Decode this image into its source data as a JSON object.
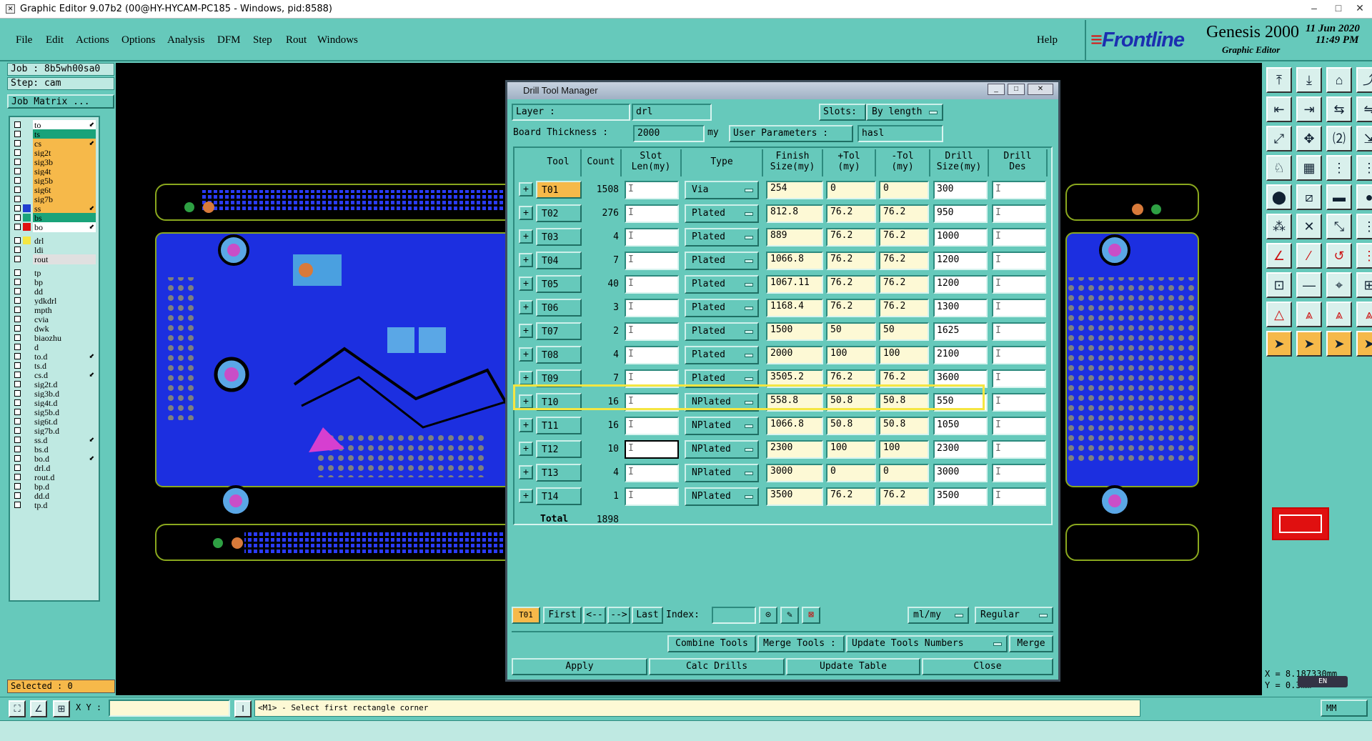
{
  "window": {
    "title": "Graphic Editor 9.07b2 (00@HY-HYCAM-PC185 - Windows, pid:8588)"
  },
  "menu": {
    "items": [
      "File",
      "Edit",
      "Actions",
      "Options",
      "Analysis",
      "DFM",
      "Step",
      "Rout",
      "Windows"
    ],
    "help": "Help"
  },
  "brand": {
    "logo": "Frontline",
    "product": "Genesis 2000",
    "subtitle": "Graphic Editor",
    "date": "11 Jun 2020",
    "time": "11:49 PM"
  },
  "left": {
    "job": "Job : 8b5wh00sa0",
    "step": "Step: cam",
    "job_matrix": "Job Matrix ...",
    "selected": "Selected : 0"
  },
  "layers": [
    {
      "name": "to",
      "color": "#ffffff",
      "arrow": true
    },
    {
      "name": "ts",
      "color": "#1aa37a",
      "arrow": false
    },
    {
      "name": "cs",
      "color": "#f6b94a",
      "arrow": true
    },
    {
      "name": "sig2t",
      "color": "#f6b94a",
      "arrow": false
    },
    {
      "name": "sig3b",
      "color": "#f6b94a",
      "arrow": false
    },
    {
      "name": "sig4t",
      "color": "#f6b94a",
      "arrow": false
    },
    {
      "name": "sig5b",
      "color": "#f6b94a",
      "arrow": false
    },
    {
      "name": "sig6t",
      "color": "#f6b94a",
      "arrow": false
    },
    {
      "name": "sig7b",
      "color": "#f6b94a",
      "arrow": false
    },
    {
      "name": "ss",
      "color": "#f6b94a",
      "arrow": true,
      "sw": "#1f3fd0"
    },
    {
      "name": "bs",
      "color": "#1aa37a",
      "arrow": false,
      "sw": "#1aa37a"
    },
    {
      "name": "bo",
      "color": "#ffffff",
      "arrow": true,
      "sw": "#e01010"
    },
    {
      "name": "drl",
      "color": "#bfe9e2",
      "arrow": false,
      "sw": "#f5e642",
      "gap": true
    },
    {
      "name": "ldi",
      "color": "#bfe9e2",
      "arrow": false
    },
    {
      "name": "rout",
      "color": "#e0e0e0",
      "arrow": false
    },
    {
      "name": "tp",
      "color": "#bfe9e2",
      "arrow": false,
      "gap": true
    },
    {
      "name": "bp",
      "color": "#bfe9e2",
      "arrow": false
    },
    {
      "name": "dd",
      "color": "#bfe9e2",
      "arrow": false
    },
    {
      "name": "ydkdrl",
      "color": "#bfe9e2",
      "arrow": false
    },
    {
      "name": "mpth",
      "color": "#bfe9e2",
      "arrow": false
    },
    {
      "name": "cvia",
      "color": "#bfe9e2",
      "arrow": false
    },
    {
      "name": "dwk",
      "color": "#bfe9e2",
      "arrow": false
    },
    {
      "name": "biaozhu",
      "color": "#bfe9e2",
      "arrow": false
    },
    {
      "name": "d",
      "color": "#bfe9e2",
      "arrow": false
    },
    {
      "name": "to.d",
      "color": "#bfe9e2",
      "arrow": true
    },
    {
      "name": "ts.d",
      "color": "#bfe9e2",
      "arrow": false
    },
    {
      "name": "cs.d",
      "color": "#bfe9e2",
      "arrow": true
    },
    {
      "name": "sig2t.d",
      "color": "#bfe9e2",
      "arrow": false
    },
    {
      "name": "sig3b.d",
      "color": "#bfe9e2",
      "arrow": false
    },
    {
      "name": "sig4t.d",
      "color": "#bfe9e2",
      "arrow": false
    },
    {
      "name": "sig5b.d",
      "color": "#bfe9e2",
      "arrow": false
    },
    {
      "name": "sig6t.d",
      "color": "#bfe9e2",
      "arrow": false
    },
    {
      "name": "sig7b.d",
      "color": "#bfe9e2",
      "arrow": false
    },
    {
      "name": "ss.d",
      "color": "#bfe9e2",
      "arrow": true
    },
    {
      "name": "bs.d",
      "color": "#bfe9e2",
      "arrow": false
    },
    {
      "name": "bo.d",
      "color": "#bfe9e2",
      "arrow": true
    },
    {
      "name": "drl.d",
      "color": "#bfe9e2",
      "arrow": false
    },
    {
      "name": "rout.d",
      "color": "#bfe9e2",
      "arrow": false
    },
    {
      "name": "bp.d",
      "color": "#bfe9e2",
      "arrow": false
    },
    {
      "name": "dd.d",
      "color": "#bfe9e2",
      "arrow": false
    },
    {
      "name": "tp.d",
      "color": "#bfe9e2",
      "arrow": false
    }
  ],
  "dialog": {
    "title": "Drill Tool Manager",
    "layer_label": "Layer          :",
    "layer_value": "drl",
    "slots_label": "Slots:",
    "slots_value": "By length",
    "thickness_label": "Board Thickness :",
    "thickness_value": "2000",
    "thickness_unit": "my",
    "user_params_label": "User Parameters :",
    "user_params_value": "hasl",
    "columns": [
      "Tool",
      "Count",
      "Slot\nLen(my)",
      "Type",
      "Finish\nSize(my)",
      "+Tol\n(my)",
      "-Tol\n(my)",
      "Drill\nSize(my)",
      "Drill\nDes"
    ],
    "rows": [
      {
        "tool": "T01",
        "count": "1508",
        "type": "Via",
        "finish": "254",
        "ptol": "0",
        "mtol": "0",
        "drill": "300"
      },
      {
        "tool": "T02",
        "count": "276",
        "type": "Plated",
        "finish": "812.8",
        "ptol": "76.2",
        "mtol": "76.2",
        "drill": "950"
      },
      {
        "tool": "T03",
        "count": "4",
        "type": "Plated",
        "finish": "889",
        "ptol": "76.2",
        "mtol": "76.2",
        "drill": "1000"
      },
      {
        "tool": "T04",
        "count": "7",
        "type": "Plated",
        "finish": "1066.8",
        "ptol": "76.2",
        "mtol": "76.2",
        "drill": "1200"
      },
      {
        "tool": "T05",
        "count": "40",
        "type": "Plated",
        "finish": "1067.11",
        "ptol": "76.2",
        "mtol": "76.2",
        "drill": "1200"
      },
      {
        "tool": "T06",
        "count": "3",
        "type": "Plated",
        "finish": "1168.4",
        "ptol": "76.2",
        "mtol": "76.2",
        "drill": "1300"
      },
      {
        "tool": "T07",
        "count": "2",
        "type": "Plated",
        "finish": "1500",
        "ptol": "50",
        "mtol": "50",
        "drill": "1625"
      },
      {
        "tool": "T08",
        "count": "4",
        "type": "Plated",
        "finish": "2000",
        "ptol": "100",
        "mtol": "100",
        "drill": "2100"
      },
      {
        "tool": "T09",
        "count": "7",
        "type": "Plated",
        "finish": "3505.2",
        "ptol": "76.2",
        "mtol": "76.2",
        "drill": "3600"
      },
      {
        "tool": "T10",
        "count": "16",
        "type": "NPlated",
        "finish": "558.8",
        "ptol": "50.8",
        "mtol": "50.8",
        "drill": "550"
      },
      {
        "tool": "T11",
        "count": "16",
        "type": "NPlated",
        "finish": "1066.8",
        "ptol": "50.8",
        "mtol": "50.8",
        "drill": "1050"
      },
      {
        "tool": "T12",
        "count": "10",
        "type": "NPlated",
        "finish": "2300",
        "ptol": "100",
        "mtol": "100",
        "drill": "2300"
      },
      {
        "tool": "T13",
        "count": "4",
        "type": "NPlated",
        "finish": "3000",
        "ptol": "0",
        "mtol": "0",
        "drill": "3000"
      },
      {
        "tool": "T14",
        "count": "1",
        "type": "NPlated",
        "finish": "3500",
        "ptol": "76.2",
        "mtol": "76.2",
        "drill": "3500"
      }
    ],
    "total_label": "Total",
    "total_value": "1898",
    "nav": {
      "current": "T01",
      "first": "First",
      "prev": "<--",
      "next": "-->",
      "last": "Last",
      "index_label": "Index:",
      "units": "ml/my",
      "mode": "Regular"
    },
    "actions": {
      "combine": "Combine Tools",
      "merge_tools": "Merge Tools :",
      "update_numbers": "Update Tools Numbers",
      "merge": "Merge",
      "apply": "Apply",
      "calc": "Calc Drills",
      "update_table": "Update Table",
      "close": "Close"
    }
  },
  "status": {
    "xy_label": "X Y :",
    "message": "<M1> - Select first rectangle corner",
    "unit": "MM"
  },
  "coords": {
    "x": "X  =   8.187330mm",
    "y": "Y  =   0.3mm"
  },
  "ime": "EN",
  "colors": {
    "panel": "#66c9bb",
    "board": "#1c2fe0",
    "highlight": "#f5e642",
    "tool_orange": "#f6b94a"
  }
}
